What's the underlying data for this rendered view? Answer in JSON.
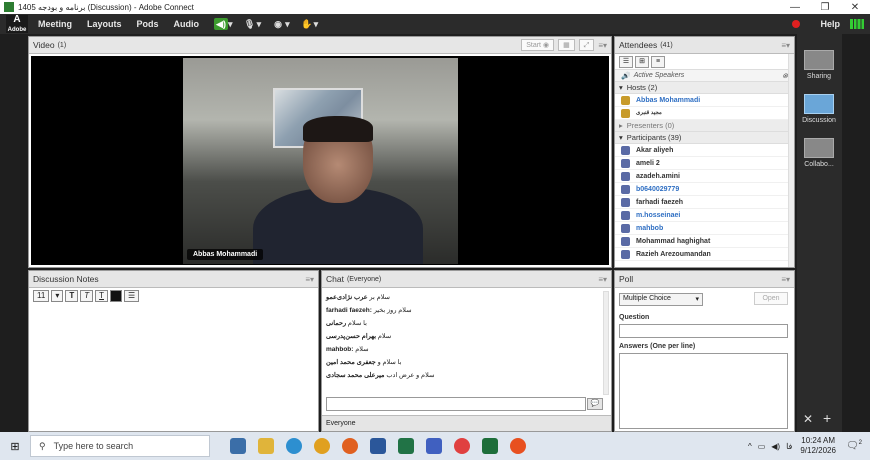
{
  "window": {
    "title": "برنامه و بودجه 1405 (Discussion) - Adobe Connect",
    "minimize": "—",
    "maximize": "❐",
    "close": "✕"
  },
  "menubar": {
    "logo": "Adobe",
    "items": [
      "Meeting",
      "Layouts",
      "Pods",
      "Audio"
    ],
    "help": "Help"
  },
  "video_pod": {
    "title": "Video",
    "count": "(1)",
    "start_label": "Start",
    "speaker_name": "Abbas Mohammadi"
  },
  "attendees_pod": {
    "title": "Attendees",
    "count": "(41)",
    "active_speakers": "Active Speakers",
    "hosts_header": "Hosts (2)",
    "hosts": [
      "Abbas Mohammadi",
      "مجید قنبری"
    ],
    "presenters_header": "Presenters (0)",
    "participants_header": "Participants (39)",
    "participants": [
      {
        "name": "Akar aliyeh",
        "blue": false
      },
      {
        "name": "ameli 2",
        "blue": false
      },
      {
        "name": "azadeh.amini",
        "blue": false
      },
      {
        "name": "b0640029779",
        "blue": true
      },
      {
        "name": "farhadi faezeh",
        "blue": false
      },
      {
        "name": "m.hosseinaei",
        "blue": true
      },
      {
        "name": "mahbob",
        "blue": true
      },
      {
        "name": "Mohammad haghighat",
        "blue": false
      },
      {
        "name": "Razieh Arezoumandan",
        "blue": false
      }
    ]
  },
  "notes_pod": {
    "title": "Discussion Notes",
    "font_size": "11"
  },
  "chat_pod": {
    "title": "Chat",
    "audience": "(Everyone)",
    "messages": [
      {
        "user": "عرب نژادی‌عمو",
        "text": "سلام بر "
      },
      {
        "user": "farhadi faezeh:",
        "text": " سلام روز بخیر"
      },
      {
        "user": "رحمانی",
        "text": "با سلام "
      },
      {
        "user": "بهرام حسن‌پدرسی",
        "text": "سلام "
      },
      {
        "user": "mahbob:",
        "text": " سلام"
      },
      {
        "user": "جعفری محمد امین",
        "text": "با سلام و "
      },
      {
        "user": "میرعلی محمد سجادی",
        "text": "سلام و عرض ادب "
      }
    ],
    "tab_label": "Everyone"
  },
  "poll_pod": {
    "title": "Poll",
    "type": "Multiple Choice",
    "open_label": "Open",
    "question_label": "Question",
    "answers_label": "Answers (One per line)"
  },
  "layouts": [
    "Sharing",
    "Discussion",
    "Collabo..."
  ],
  "taskbar": {
    "search_placeholder": "Type here to search",
    "time": "10:24 AM",
    "date": "9/12/2026",
    "notifications": "2"
  }
}
